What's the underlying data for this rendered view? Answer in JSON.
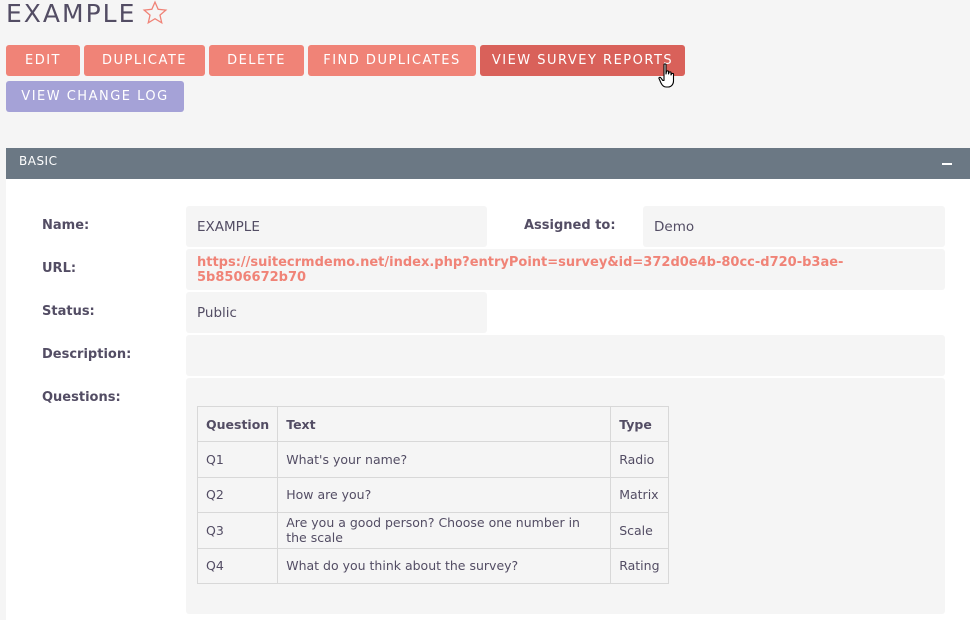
{
  "header": {
    "title": "EXAMPLE"
  },
  "actions": {
    "edit": "EDIT",
    "duplicate": "DUPLICATE",
    "delete": "DELETE",
    "find_duplicates": "FIND DUPLICATES",
    "view_survey_reports": "VIEW SURVEY REPORTS",
    "view_change_log": "VIEW CHANGE LOG"
  },
  "panel": {
    "title": "BASIC"
  },
  "fields": {
    "name_label": "Name:",
    "name_value": "EXAMPLE",
    "assigned_label": "Assigned to:",
    "assigned_value": "Demo",
    "url_label": "URL:",
    "url_value": "https://suitecrmdemo.net/index.php?entryPoint=survey&id=372d0e4b-80cc-d720-b3ae-5b8506672b70",
    "status_label": "Status:",
    "status_value": "Public",
    "description_label": "Description:",
    "description_value": "",
    "questions_label": "Questions:"
  },
  "questions_table": {
    "headers": [
      "Question",
      "Text",
      "Type"
    ],
    "rows": [
      [
        "Q1",
        "What's your name?",
        "Radio"
      ],
      [
        "Q2",
        "How are you?",
        "Matrix"
      ],
      [
        "Q3",
        "Are you a good person? Choose one number in the scale",
        "Scale"
      ],
      [
        "Q4",
        "What do you think about the survey?",
        "Rating"
      ]
    ]
  },
  "colors": {
    "accent": "#f08377",
    "accent_active": "#d9615a",
    "secondary": "#a5a2d7",
    "panel_header": "#6b7884"
  },
  "icons": {
    "favorite": "star-outline-icon",
    "collapse": "minus-icon",
    "cursor": "hand-pointer-icon"
  }
}
